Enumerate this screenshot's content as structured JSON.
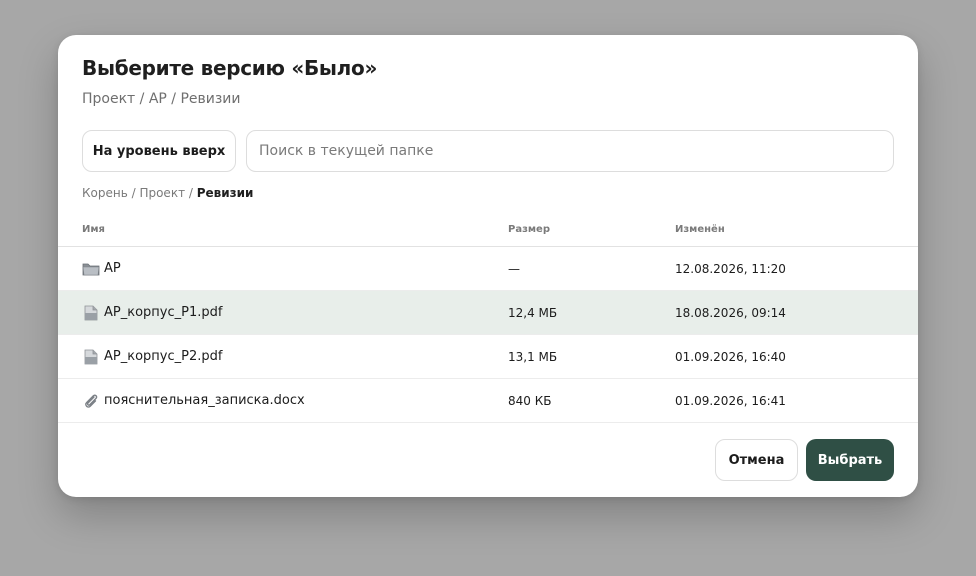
{
  "dialog": {
    "title": "Выберите версию «Было»",
    "subtitle": "Проект / АР / Ревизии"
  },
  "toolbar": {
    "up_label": "На уровень вверх",
    "search_placeholder": "Поиск в текущей папке",
    "search_value": ""
  },
  "breadcrumb": {
    "items": [
      "Корень",
      "Проект"
    ],
    "separator": " / ",
    "current": "Ревизии"
  },
  "table": {
    "headers": {
      "name": "Имя",
      "size": "Размер",
      "modified": "Изменён"
    },
    "rows": [
      {
        "icon": "folder-icon",
        "name": "АР",
        "size": "—",
        "modified": "12.08.2026, 11:20",
        "selected": false
      },
      {
        "icon": "file-icon",
        "name": "АР_корпус_Р1.pdf",
        "size": "12,4 МБ",
        "modified": "18.08.2026, 09:14",
        "selected": true
      },
      {
        "icon": "file-icon",
        "name": "АР_корпус_Р2.pdf",
        "size": "13,1 МБ",
        "modified": "01.09.2026, 16:40",
        "selected": false
      },
      {
        "icon": "paperclip-icon",
        "name": "пояснительная_записка.docx",
        "size": "840 КБ",
        "modified": "01.09.2026, 16:41",
        "selected": false
      }
    ]
  },
  "footer": {
    "cancel_label": "Отмена",
    "select_label": "Выбрать"
  },
  "colors": {
    "primary": "#2f4f45",
    "selected_row": "#e8eeea",
    "backdrop": "#a7a7a7"
  }
}
